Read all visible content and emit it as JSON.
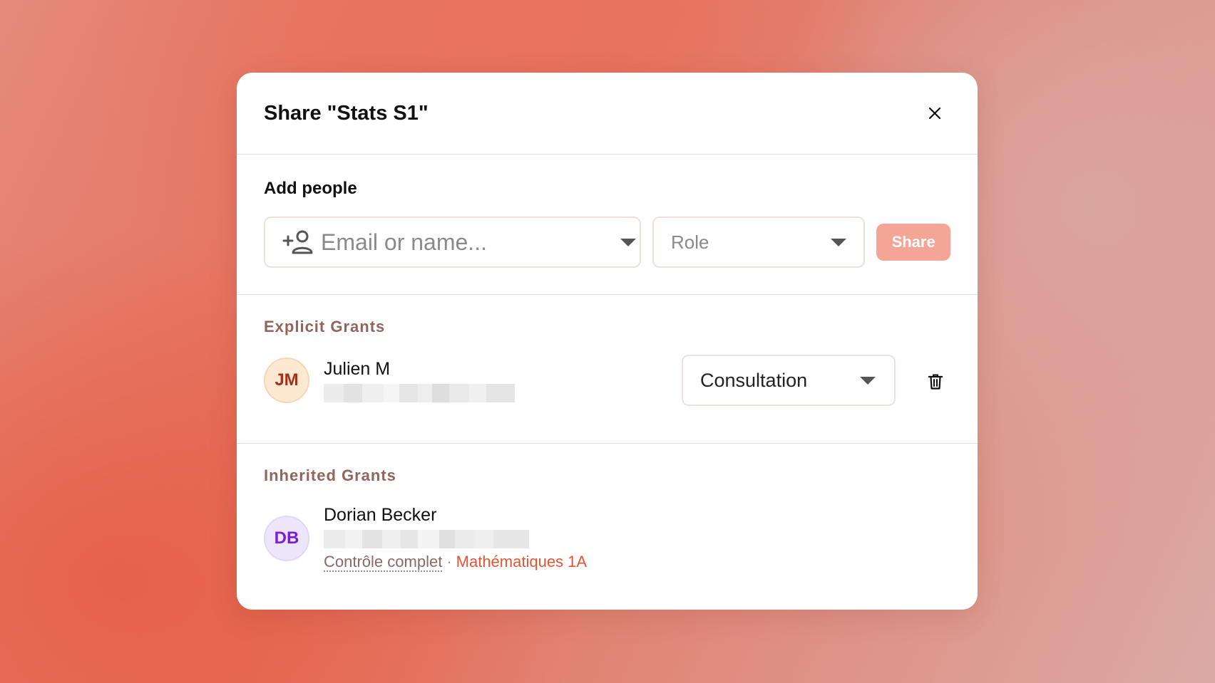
{
  "dialog": {
    "title": "Share \"Stats S1\""
  },
  "add_people": {
    "label": "Add people",
    "input_placeholder": "Email or name...",
    "role_placeholder": "Role",
    "share_label": "Share"
  },
  "explicit_grants": {
    "heading": "Explicit Grants",
    "items": [
      {
        "initials": "JM",
        "name": "Julien M",
        "role": "Consultation"
      }
    ]
  },
  "inherited_grants": {
    "heading": "Inherited Grants",
    "items": [
      {
        "initials": "DB",
        "name": "Dorian Becker",
        "role": "Contrôle complet",
        "source": "Mathématiques 1A"
      }
    ]
  },
  "colors": {
    "share_button": "#f4a596",
    "accent_red": "#e25536",
    "section_heading": "#93645c"
  },
  "icons": [
    "close-icon",
    "add-person-icon",
    "chevron-down-icon",
    "trash-icon"
  ]
}
